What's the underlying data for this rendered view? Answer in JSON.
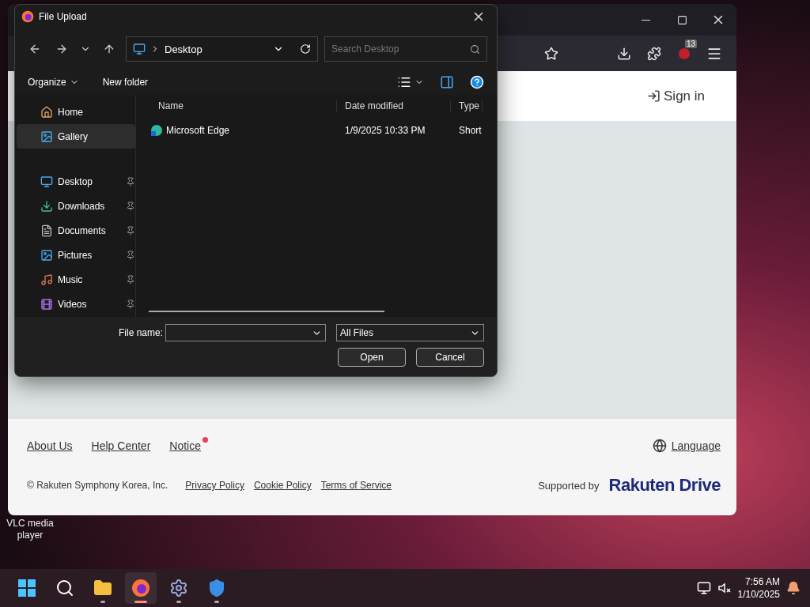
{
  "desktop": {
    "icon_label": "VLC media player"
  },
  "browser": {
    "extension_badge": "13",
    "sign_in": "Sign in",
    "footer": {
      "links": [
        {
          "label": "About Us",
          "unread": false
        },
        {
          "label": "Help Center",
          "unread": false
        },
        {
          "label": "Notice",
          "unread": true
        }
      ],
      "language": "Language",
      "copyright": "© Rakuten Symphony Korea, Inc.",
      "legal_links": [
        "Privacy Policy",
        "Cookie Policy",
        "Terms of Service"
      ],
      "supported_by": "Supported by",
      "brand": "Rakuten Drive"
    }
  },
  "dialog": {
    "title": "File Upload",
    "location": "Desktop",
    "search": {
      "placeholder": "Search Desktop"
    },
    "commands": [
      "Organize",
      "New folder"
    ],
    "sidebar": [
      {
        "kind": "home",
        "label": "Home",
        "selected": false,
        "pinned": false
      },
      {
        "kind": "gallery",
        "label": "Gallery",
        "selected": true,
        "pinned": false
      },
      {
        "kind": "desktop",
        "label": "Desktop",
        "selected": false,
        "pinned": true
      },
      {
        "kind": "downloads",
        "label": "Downloads",
        "selected": false,
        "pinned": true
      },
      {
        "kind": "documents",
        "label": "Documents",
        "selected": false,
        "pinned": true
      },
      {
        "kind": "pictures",
        "label": "Pictures",
        "selected": false,
        "pinned": true
      },
      {
        "kind": "music",
        "label": "Music",
        "selected": false,
        "pinned": true
      },
      {
        "kind": "videos",
        "label": "Videos",
        "selected": false,
        "pinned": true
      }
    ],
    "columns": [
      "Name",
      "Date modified",
      "Type"
    ],
    "rows": [
      {
        "name": "Microsoft Edge",
        "date": "1/9/2025 10:33 PM",
        "type": "Short"
      }
    ],
    "file_name_label": "File name:",
    "filter": "All Files",
    "buttons": [
      "Open",
      "Cancel"
    ]
  },
  "taskbar": {
    "apps": [
      {
        "kind": "start",
        "running": false,
        "selected": false
      },
      {
        "kind": "search",
        "running": false,
        "selected": false
      },
      {
        "kind": "files",
        "running": true,
        "selected": false
      },
      {
        "kind": "firefox",
        "running": true,
        "selected": true
      },
      {
        "kind": "settings",
        "running": true,
        "selected": false
      },
      {
        "kind": "defender",
        "running": true,
        "selected": false
      }
    ],
    "time": "7:56 AM",
    "date": "1/10/2025"
  }
}
